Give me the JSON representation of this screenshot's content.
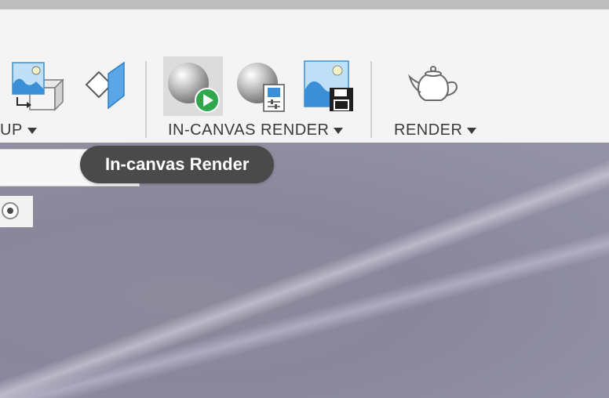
{
  "toolbar": {
    "groups": [
      {
        "label": "UP"
      },
      {
        "label": "IN-CANVAS RENDER"
      },
      {
        "label": "RENDER"
      }
    ]
  },
  "tooltip": {
    "text": "In-canvas Render"
  },
  "colors": {
    "accent_blue": "#3a8fd6",
    "play_green": "#2ea84a",
    "tooltip_bg": "#4a4a4a",
    "active_button_bg": "#dcdcdc"
  },
  "icons": [
    "scene-settings-icon",
    "section-plane-icon",
    "in-canvas-render-icon",
    "in-canvas-render-settings-icon",
    "capture-image-icon",
    "render-teapot-icon"
  ]
}
